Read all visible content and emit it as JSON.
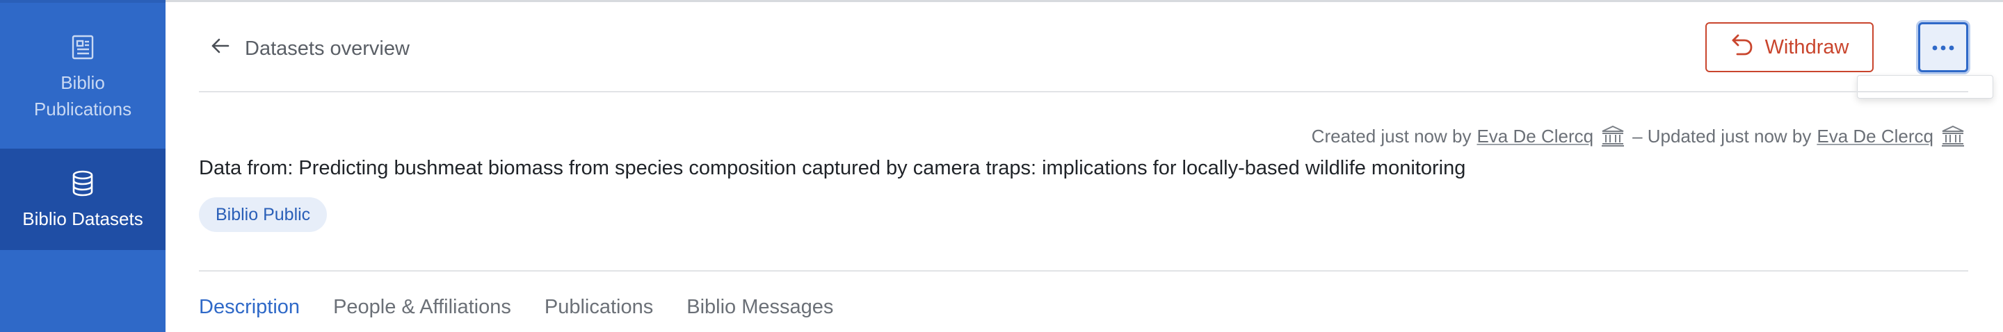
{
  "sidebar": {
    "items": [
      {
        "label": "Biblio Publications",
        "icon": "publication-icon",
        "active": false
      },
      {
        "label": "Biblio Datasets",
        "icon": "database-icon",
        "active": true
      }
    ]
  },
  "header": {
    "back_label": "Datasets overview",
    "withdraw_label": "Withdraw",
    "more_icon": "ellipsis-icon"
  },
  "meta": {
    "created_prefix": "Created just now by",
    "created_by": "Eva De Clercq",
    "separator": "– Updated just now by",
    "updated_by": "Eva De Clercq"
  },
  "dataset": {
    "title": "Data from: Predicting bushmeat biomass from species composition captured by camera traps: implications for locally-based wildlife monitoring",
    "badge": "Biblio Public"
  },
  "tabs": [
    {
      "label": "Description",
      "active": true
    },
    {
      "label": "People & Affiliations",
      "active": false
    },
    {
      "label": "Publications",
      "active": false
    },
    {
      "label": "Biblio Messages",
      "active": false
    }
  ],
  "colors": {
    "sidebar": "#2f69c8",
    "sidebar_active": "#1f4ea5",
    "danger": "#c9452d",
    "primary": "#2f69c8"
  }
}
